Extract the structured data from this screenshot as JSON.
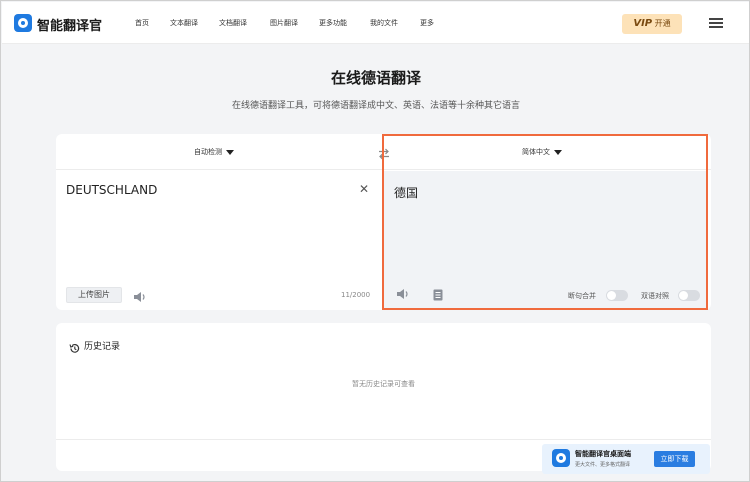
{
  "nav": {
    "brand": "智能翻译官",
    "items": [
      "首页",
      "文本翻译",
      "文档翻译",
      "图片翻译",
      "更多功能",
      "我的文件",
      "更多"
    ],
    "vip_prefix": "VIP",
    "vip_label": "开通"
  },
  "page": {
    "title": "在线德语翻译",
    "subtitle": "在线德语翻译工具，可将德语翻译成中文、英语、法语等十余种其它语言"
  },
  "translator": {
    "source_lang": "自动检测",
    "target_lang": "简体中文",
    "source_text": "DEUTSCHLAND",
    "clear_symbol": "✕",
    "upload_label": "上传图片",
    "char_count": "11/2000",
    "target_text": "德国",
    "toggle1_label": "断句合并",
    "toggle2_label": "双语对照"
  },
  "history": {
    "title": "历史记录",
    "empty_text": "暂无历史记录可查看"
  },
  "banner": {
    "title": "智能翻译官桌面端",
    "subtitle": "更大文件、更多格式翻译",
    "button_label": "立即下载"
  },
  "colors": {
    "accent": "#1f7ae0",
    "highlight": "#f06a3d",
    "vip_bg": "#fde2b8"
  }
}
